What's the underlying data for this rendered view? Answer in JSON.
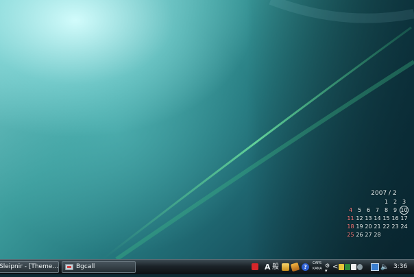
{
  "taskbar": {
    "tasks": [
      {
        "label": "Sleipnir - [Theme..."
      },
      {
        "label": "Bgcall"
      }
    ]
  },
  "tray": {
    "ime_char": "A",
    "ime_mode": "般",
    "help": "?",
    "caps": "CAPS",
    "kana": "KANA",
    "expand": "<"
  },
  "clock": {
    "time": "3:36"
  },
  "calendar": {
    "title": "2007 / 2",
    "days": [
      "",
      "",
      "",
      "",
      "1",
      "2",
      "3",
      "4",
      "5",
      "6",
      "7",
      "8",
      "9",
      "10",
      "11",
      "12",
      "13",
      "14",
      "15",
      "16",
      "17",
      "18",
      "19",
      "20",
      "21",
      "22",
      "23",
      "24",
      "25",
      "26",
      "27",
      "28",
      "",
      "",
      ""
    ],
    "today": "10",
    "weekend_color": "#ff7a7a"
  },
  "colors": {
    "wallpaper_highlight": "#d7ffff",
    "wallpaper_base": "#267a80",
    "wallpaper_streak": "#57d28a",
    "taskbar": "#1b2328"
  }
}
